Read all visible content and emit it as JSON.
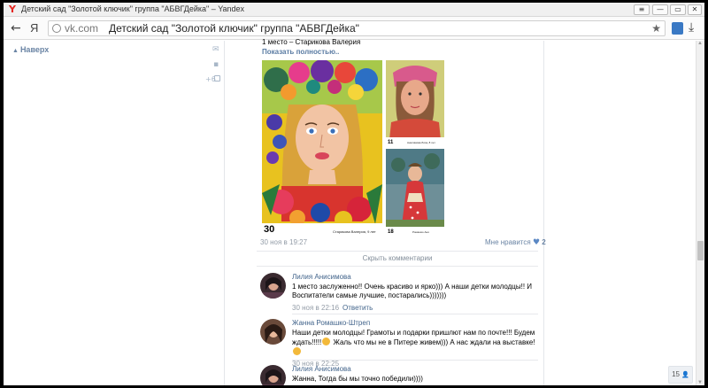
{
  "browser": {
    "window_title": "Детский сад \"Золотой ключик\" группа \"АБВГДейка\" – Yandex",
    "logo_glyph": "Y",
    "buttons": {
      "menu": "≡",
      "minimize": "—",
      "maximize": "▭",
      "close": "✕"
    },
    "back_glyph": "←",
    "ya_glyph": "Я",
    "url_domain": "vk.com",
    "url_page_title": "Детский сад \"Золотой ключик\" группа \"АБВГДейка\"",
    "star_glyph": "★",
    "download_glyph": "⤓"
  },
  "sidebar": {
    "up_arrow": "▲",
    "up_label": "Наверх",
    "messages_icon": "✉",
    "chat_icon": "▪",
    "plus_badge": "+6"
  },
  "post": {
    "text_line": "1 место – Старикова Валерия",
    "show_full": "Показать полностью..",
    "images": [
      {
        "number": "30",
        "caption": "Старикова Валерия, 9 лет"
      },
      {
        "number": "11",
        "caption": "Анисимова Лиза, 8 лет"
      },
      {
        "number": "18",
        "caption": "Ромашко Аня"
      }
    ],
    "date": "30 ноя в 19:27",
    "like_label": "Мне нравится",
    "like_heart": "♥",
    "like_count": "2",
    "hide_comments": "Скрыть комментарии"
  },
  "comments": [
    {
      "author": "Лилия Анисимова",
      "text": "1 место заслуженно!! Очень красиво и ярко))) А наши детки молодцы!! И Воспитатели самые лучшие, постарались)))))))",
      "time": "30 ноя в 22:16",
      "reply": "Ответить"
    },
    {
      "author": "Жанна Ромашко-Штреп",
      "text_part1": "Наши детки молодцы! Грамоты и подарки пришлют нам по почте!!! Будем ждать!!!!!",
      "text_part2": " Жаль что мы не в Питере живем))) А нас ждали на выставке!",
      "time": "30 ноя в 22:25"
    },
    {
      "author": "Лилия Анисимова",
      "text": "Жанна, Тогда бы мы точно победили))))"
    }
  ],
  "widget": {
    "count": "15",
    "icon": "👤"
  },
  "scrollbar": {
    "up": "▲",
    "down": "▼"
  }
}
